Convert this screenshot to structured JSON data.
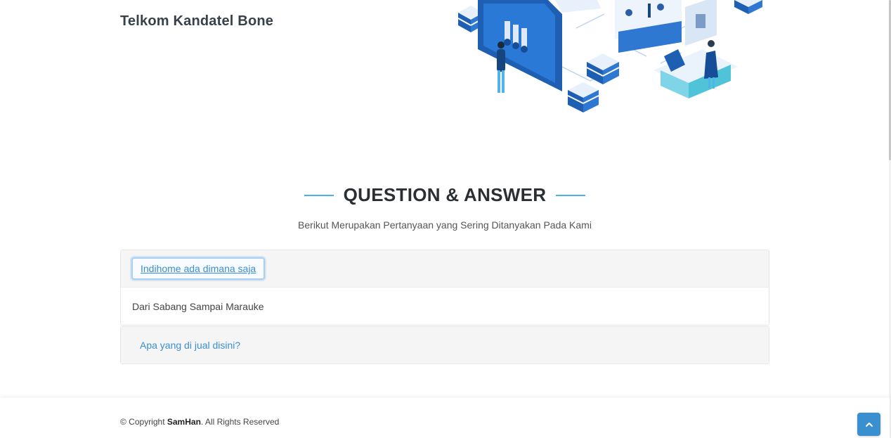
{
  "header": {
    "brand": "Telkom Kandatel Bone"
  },
  "faq_section": {
    "title": "QUESTION & ANSWER",
    "subtitle": "Berikut Merupakan Pertanyaan yang Sering Ditanyakan Pada Kami",
    "items": [
      {
        "question": "Indihome ada dimana saja",
        "answer": "Dari Sabang Sampai Marauke",
        "expanded": true
      },
      {
        "question": "Apa yang di jual disini?",
        "expanded": false
      }
    ]
  },
  "footer": {
    "copyright_prefix": "© Copyright ",
    "copyright_brand": "SamHan",
    "copyright_suffix": ". All Rights Reserved"
  },
  "colors": {
    "accent": "#47b2e4",
    "link": "#3a8fd0",
    "heading": "#2b2f33"
  },
  "icons": {
    "back_to_top": "chevron-up-icon"
  }
}
